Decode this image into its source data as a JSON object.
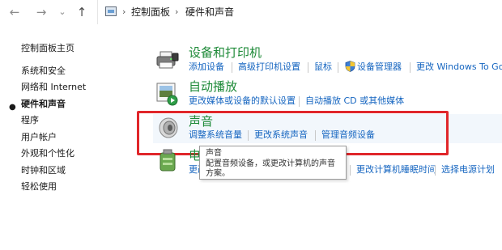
{
  "nav": {
    "back": "←",
    "forward": "→",
    "dropdown": "⌄",
    "up": "↑",
    "crumb_arrow": "›",
    "breadcrumb": [
      "控制面板",
      "硬件和声音"
    ]
  },
  "sidebar": {
    "items": [
      {
        "label": "控制面板主页"
      },
      {
        "label": "系统和安全"
      },
      {
        "label": "网络和 Internet"
      },
      {
        "label": "硬件和声音",
        "active": true
      },
      {
        "label": "程序"
      },
      {
        "label": "用户帐户"
      },
      {
        "label": "外观和个性化"
      },
      {
        "label": "时钟和区域"
      },
      {
        "label": "轻松使用"
      }
    ]
  },
  "categories": {
    "devices": {
      "title": "设备和打印机",
      "icon": "printer-icon",
      "links": [
        "添加设备",
        "高级打印机设置",
        "鼠标",
        "设备管理器",
        "更改 Windows To Go"
      ]
    },
    "autoplay": {
      "title": "自动播放",
      "icon": "autoplay-icon",
      "links": [
        "更改媒体或设备的默认设置",
        "自动播放 CD 或其他媒体"
      ]
    },
    "sound": {
      "title": "声音",
      "icon": "speaker-icon",
      "links": [
        "调整系统音量",
        "更改系统声音",
        "管理音频设备"
      ]
    },
    "power": {
      "title_fragment": "电",
      "icon": "power-options-icon",
      "links": [
        "更改",
        "更改计算机睡眠时间",
        "选择电源计划"
      ]
    }
  },
  "tooltip": {
    "title": "声音",
    "line1": "配置音频设备，或更改计算机的声音",
    "line2": "方案。"
  },
  "colors": {
    "category_title": "#1e8a38",
    "link": "#1565c0",
    "highlight": "#e0262a"
  }
}
